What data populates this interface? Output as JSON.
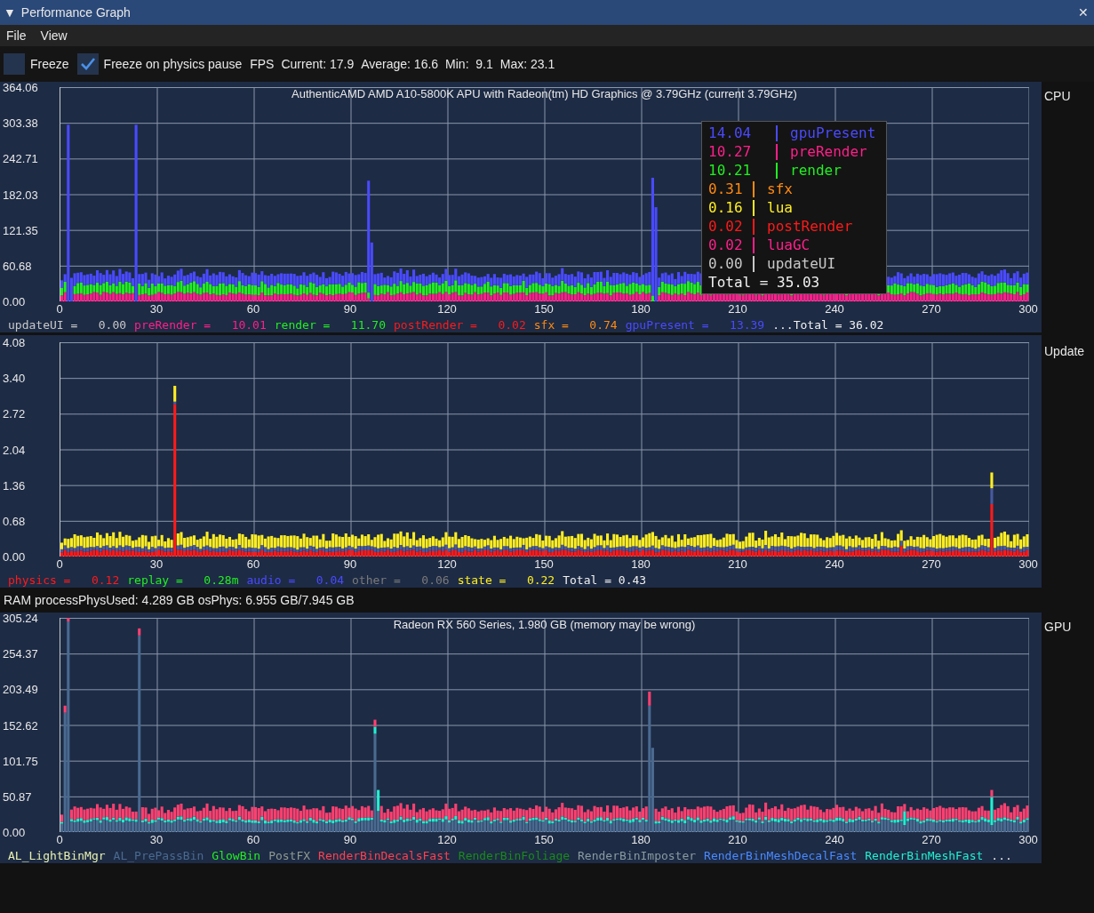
{
  "window": {
    "collapse_glyph": "▼",
    "title": "Performance Graph",
    "close_glyph": "✕"
  },
  "menu": [
    "File",
    "View"
  ],
  "toolbar": {
    "checkboxes": [
      {
        "label": "Freeze",
        "checked": false
      },
      {
        "label": "Freeze on physics pause",
        "checked": true
      }
    ],
    "fps": [
      "FPS",
      "Current: 17.9",
      "Average: 16.6",
      "Min:  9.1",
      "Max: 23.1"
    ]
  },
  "panels": [
    {
      "kind": "cpu",
      "side_label": "CPU",
      "title": "AuthenticAMD AMD A10-5800K APU with Radeon(tm) HD Graphics   @ 3.79GHz (current 3.79GHz)",
      "yticks": [
        "364.06",
        "303.38",
        "242.71",
        "182.03",
        "121.35",
        "60.68",
        "0.00"
      ],
      "xticks": [
        "0",
        "30",
        "60",
        "90",
        "120",
        "150",
        "180",
        "210",
        "240",
        "270",
        "300"
      ],
      "legend": [
        {
          "label": "updateUI =",
          "value": "0.00",
          "color": "#c8c8c8"
        },
        {
          "label": "preRender =",
          "value": "10.01",
          "color": "#ff1f8a"
        },
        {
          "label": "render =",
          "value": "11.70",
          "color": "#22ee22"
        },
        {
          "label": "postRender =",
          "value": "0.02",
          "color": "#ff1a1a"
        },
        {
          "label": "sfx =",
          "value": "0.74",
          "color": "#ff8a10"
        },
        {
          "label": "gpuPresent =",
          "value": "13.39",
          "color": "#4a4aff"
        }
      ],
      "legend_total": "...Total = 36.02",
      "tooltip": {
        "rows": [
          {
            "value": "14.04",
            "name": "gpuPresent",
            "color": "#4a4aff"
          },
          {
            "value": "10.27",
            "name": "preRender",
            "color": "#ff1f8a"
          },
          {
            "value": "10.21",
            "name": "render",
            "color": "#22ee22"
          },
          {
            "value": "0.31",
            "name": "sfx",
            "color": "#ff8a10"
          },
          {
            "value": "0.16",
            "name": "lua",
            "color": "#ffee22"
          },
          {
            "value": "0.02",
            "name": "postRender",
            "color": "#ff1a1a"
          },
          {
            "value": "0.02",
            "name": "luaGC",
            "color": "#ff1f8a"
          },
          {
            "value": "0.00",
            "name": "updateUI",
            "color": "#c8c8c8"
          }
        ],
        "total": "Total = 35.03"
      }
    },
    {
      "kind": "update",
      "side_label": "Update",
      "yticks": [
        "4.08",
        "3.40",
        "2.72",
        "2.04",
        "1.36",
        "0.68",
        "0.00"
      ],
      "xticks": [
        "0",
        "30",
        "60",
        "90",
        "120",
        "150",
        "180",
        "210",
        "240",
        "270",
        "300"
      ],
      "legend": [
        {
          "label": "physics =",
          "value": "0.12",
          "color": "#ff1a1a"
        },
        {
          "label": "replay =",
          "value": "0.28m",
          "color": "#22ee22"
        },
        {
          "label": "audio =",
          "value": "0.04",
          "color": "#4a4aff"
        },
        {
          "label": "other =",
          "value": "0.06",
          "color": "#7a7a7a"
        },
        {
          "label": "state =",
          "value": "0.22",
          "color": "#ffee22"
        }
      ],
      "legend_total": "Total = 0.43"
    },
    {
      "kind": "gpu",
      "header": "RAM  processPhysUsed: 4.289 GB  osPhys: 6.955 GB/7.945 GB",
      "side_label": "GPU",
      "title": "Radeon RX 560 Series, 1.980 GB (memory may be wrong)",
      "yticks": [
        "305.24",
        "254.37",
        "203.49",
        "152.62",
        "101.75",
        "50.87",
        "0.00"
      ],
      "xticks": [
        "0",
        "30",
        "60",
        "90",
        "120",
        "150",
        "180",
        "210",
        "240",
        "270",
        "300"
      ],
      "legend": [
        {
          "label": "AL_LightBinMgr",
          "color": "#e8f0b0"
        },
        {
          "label": "AL_PrePassBin",
          "color": "#4a6a90"
        },
        {
          "label": "GlowBin",
          "color": "#22ee22"
        },
        {
          "label": "PostFX",
          "color": "#909a90"
        },
        {
          "label": "RenderBinDecalsFast",
          "color": "#ff4050"
        },
        {
          "label": "RenderBinFoliage",
          "color": "#1a8a1a"
        },
        {
          "label": "RenderBinImposter",
          "color": "#8a9aa0"
        },
        {
          "label": "RenderBinMeshDecalFast",
          "color": "#4a8aff"
        },
        {
          "label": "RenderBinMeshFast",
          "color": "#20f0d0"
        }
      ],
      "legend_total": "..."
    }
  ]
}
